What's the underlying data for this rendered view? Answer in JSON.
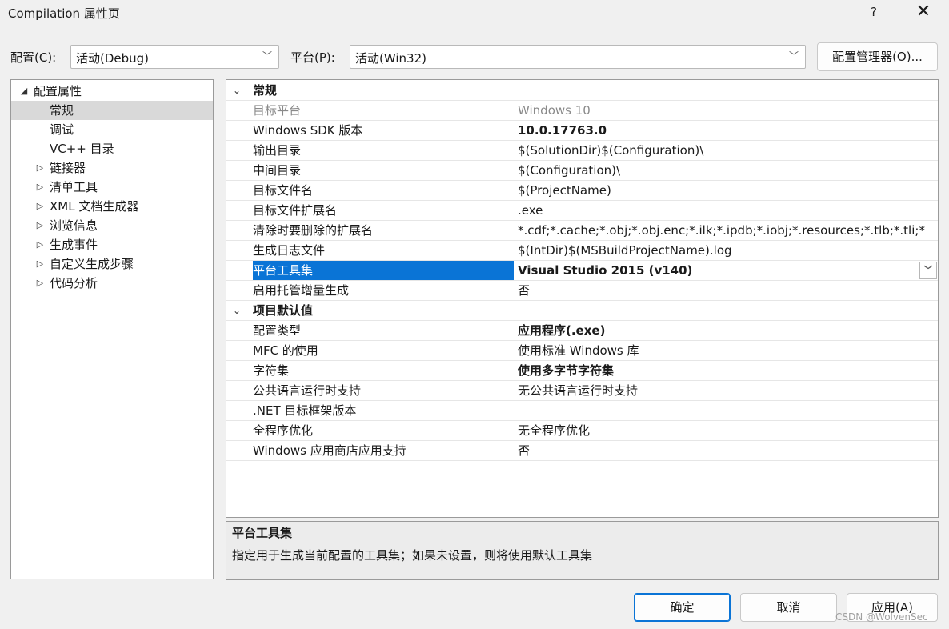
{
  "window": {
    "title": "Compilation 属性页",
    "help_label": "?",
    "close_label": "✕"
  },
  "config_bar": {
    "config_label": "配置(C):",
    "config_value": "活动(Debug)",
    "platform_label": "平台(P):",
    "platform_value": "活动(Win32)",
    "manager_button": "配置管理器(O)...",
    "dropdown_icon": "chevron-down-icon"
  },
  "tree": {
    "root": {
      "label": "配置属性",
      "expanded": true
    },
    "items": [
      {
        "label": "常规",
        "selected": true,
        "expandable": false
      },
      {
        "label": "调试",
        "selected": false,
        "expandable": false
      },
      {
        "label": "VC++ 目录",
        "selected": false,
        "expandable": false
      },
      {
        "label": "链接器",
        "selected": false,
        "expandable": true
      },
      {
        "label": "清单工具",
        "selected": false,
        "expandable": true
      },
      {
        "label": "XML 文档生成器",
        "selected": false,
        "expandable": true
      },
      {
        "label": "浏览信息",
        "selected": false,
        "expandable": true
      },
      {
        "label": "生成事件",
        "selected": false,
        "expandable": true
      },
      {
        "label": "自定义生成步骤",
        "selected": false,
        "expandable": true
      },
      {
        "label": "代码分析",
        "selected": false,
        "expandable": true
      }
    ]
  },
  "grid": {
    "categories": [
      {
        "name": "常规",
        "rows": [
          {
            "name": "目标平台",
            "value": "Windows 10",
            "disabled": true
          },
          {
            "name": "Windows SDK 版本",
            "value": "10.0.17763.0",
            "bold": true
          },
          {
            "name": "输出目录",
            "value": "$(SolutionDir)$(Configuration)\\"
          },
          {
            "name": "中间目录",
            "value": "$(Configuration)\\"
          },
          {
            "name": "目标文件名",
            "value": "$(ProjectName)"
          },
          {
            "name": "目标文件扩展名",
            "value": ".exe"
          },
          {
            "name": "清除时要删除的扩展名",
            "value": "*.cdf;*.cache;*.obj;*.obj.enc;*.ilk;*.ipdb;*.iobj;*.resources;*.tlb;*.tli;*"
          },
          {
            "name": "生成日志文件",
            "value": "$(IntDir)$(MSBuildProjectName).log"
          },
          {
            "name": "平台工具集",
            "value": "Visual Studio 2015 (v140)",
            "bold": true,
            "selected": true
          },
          {
            "name": "启用托管增量生成",
            "value": "否"
          }
        ]
      },
      {
        "name": "项目默认值",
        "rows": [
          {
            "name": "配置类型",
            "value": "应用程序(.exe)",
            "bold": true
          },
          {
            "name": "MFC 的使用",
            "value": "使用标准 Windows 库"
          },
          {
            "name": "字符集",
            "value": "使用多字节字符集",
            "bold": true
          },
          {
            "name": "公共语言运行时支持",
            "value": "无公共语言运行时支持"
          },
          {
            "name": ".NET 目标框架版本",
            "value": ""
          },
          {
            "name": "全程序优化",
            "value": "无全程序优化"
          },
          {
            "name": "Windows 应用商店应用支持",
            "value": "否"
          }
        ]
      }
    ]
  },
  "description": {
    "title": "平台工具集",
    "text": "指定用于生成当前配置的工具集；如果未设置，则将使用默认工具集"
  },
  "buttons": {
    "ok": "确定",
    "cancel": "取消",
    "apply": "应用(A)"
  },
  "watermark": "CSDN @WolvenSec",
  "colors": {
    "selection": "#0a74d6",
    "tree_selection": "#d9d9d9",
    "background": "#f0f0f0"
  }
}
